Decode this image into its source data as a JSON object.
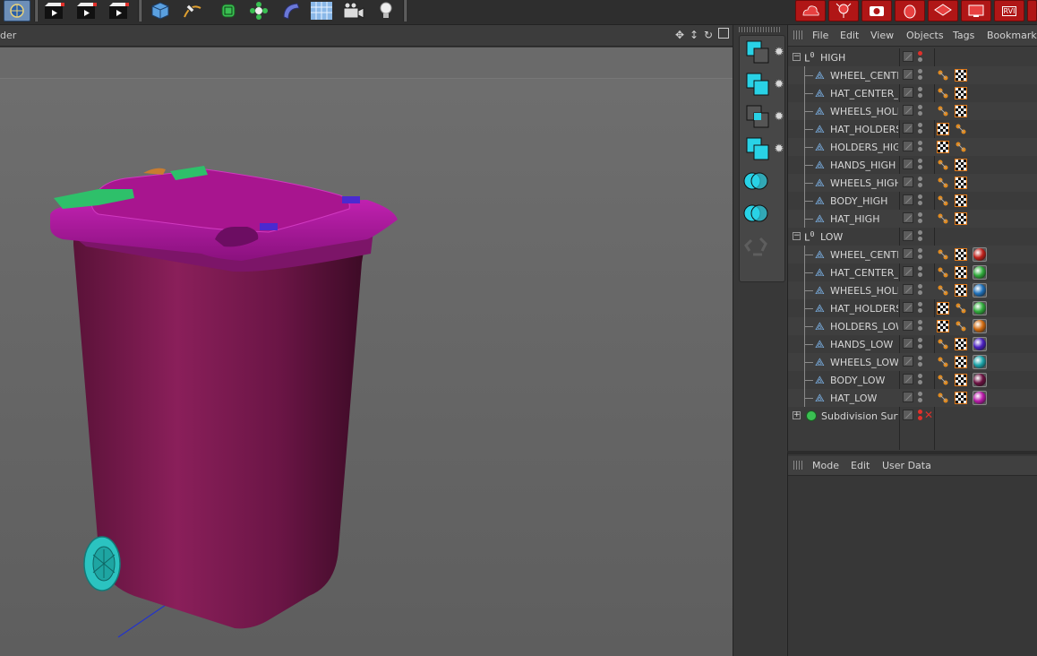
{
  "viewport": {
    "label": "der",
    "nav_icons": [
      "move-view-icon",
      "zoom-view-icon",
      "rotate-view-icon",
      "maximize-view-icon"
    ]
  },
  "toolbar": {
    "left_icons": [
      "coordinate-system-icon",
      "render-view-icon",
      "render-picture-queue-icon",
      "render-settings-icon"
    ],
    "object_icons": [
      "cube-icon",
      "pen-spline-icon",
      "subdivision-icon",
      "array-icon",
      "deformer-icon",
      "floor-icon",
      "camera-icon",
      "light-icon"
    ],
    "plugin_icons": [
      "plugin-cloud-icon",
      "plugin-tree-icon",
      "plugin-camera-icon",
      "plugin-figure-icon",
      "plugin-layers-icon",
      "plugin-monitor-icon",
      "plugin-rvl-icon"
    ],
    "plugin_text": "RVI"
  },
  "palette": {
    "tools": [
      "palette-tool-1",
      "palette-tool-2",
      "palette-tool-3",
      "palette-tool-4",
      "boolean-icon",
      "boolean-2-icon",
      "recycle-icon"
    ]
  },
  "object_manager": {
    "menu": [
      "File",
      "Edit",
      "View",
      "Objects",
      "Tags",
      "Bookmarks"
    ],
    "rows": [
      {
        "label": "HIGH",
        "kind": "null",
        "level": 0,
        "expanded": true,
        "tags": []
      },
      {
        "label": "WHEEL_CENTE",
        "kind": "poly",
        "level": 1,
        "tags": [
          "ik",
          "chk"
        ]
      },
      {
        "label": "HAT_CENTER_H",
        "kind": "poly",
        "level": 1,
        "tags": [
          "ik",
          "chk"
        ]
      },
      {
        "label": "WHEELS_HOLD",
        "kind": "poly",
        "level": 1,
        "tags": [
          "ik",
          "chk"
        ]
      },
      {
        "label": "HAT_HOLDERS",
        "kind": "poly",
        "level": 1,
        "tags": [
          "chk",
          "ik"
        ]
      },
      {
        "label": "HOLDERS_HIGH",
        "kind": "poly",
        "level": 1,
        "tags": [
          "chk",
          "ik"
        ]
      },
      {
        "label": "HANDS_HIGH",
        "kind": "poly",
        "level": 1,
        "tags": [
          "ik",
          "chk"
        ]
      },
      {
        "label": "WHEELS_HIGH",
        "kind": "poly",
        "level": 1,
        "tags": [
          "ik",
          "chk"
        ]
      },
      {
        "label": "BODY_HIGH",
        "kind": "poly",
        "level": 1,
        "tags": [
          "ik",
          "chk"
        ]
      },
      {
        "label": "HAT_HIGH",
        "kind": "poly",
        "level": 1,
        "tags": [
          "ik",
          "chk"
        ]
      },
      {
        "label": "LOW",
        "kind": "null",
        "level": 0,
        "expanded": true,
        "tags": []
      },
      {
        "label": "WHEEL_CENTE",
        "kind": "poly",
        "level": 1,
        "tags": [
          "ik",
          "chk",
          "mat:#c0201a"
        ]
      },
      {
        "label": "HAT_CENTER_L",
        "kind": "poly",
        "level": 1,
        "tags": [
          "ik",
          "chk",
          "mat:#2faa3a"
        ]
      },
      {
        "label": "WHEELS_HOLD",
        "kind": "poly",
        "level": 1,
        "tags": [
          "ik",
          "chk",
          "mat:#1e6fb8"
        ]
      },
      {
        "label": "HAT_HOLDERS",
        "kind": "poly",
        "level": 1,
        "tags": [
          "chk",
          "ik",
          "mat:#2faa3a"
        ]
      },
      {
        "label": "HOLDERS_LOW",
        "kind": "poly",
        "level": 1,
        "tags": [
          "chk",
          "ik",
          "mat:#d06a10"
        ]
      },
      {
        "label": "HANDS_LOW",
        "kind": "poly",
        "level": 1,
        "tags": [
          "ik",
          "chk",
          "mat:#4a1fc0"
        ]
      },
      {
        "label": "WHEELS_LOW",
        "kind": "poly",
        "level": 1,
        "tags": [
          "ik",
          "chk",
          "mat:#1aa3a8"
        ]
      },
      {
        "label": "BODY_LOW",
        "kind": "poly",
        "level": 1,
        "tags": [
          "ik",
          "chk",
          "mat:#6a1040"
        ]
      },
      {
        "label": "HAT_LOW",
        "kind": "poly",
        "level": 1,
        "tags": [
          "ik",
          "chk",
          "mat:#b81aa8"
        ]
      },
      {
        "label": "Subdivision Surfa",
        "kind": "subdiv",
        "level": 0,
        "expanded": false,
        "tags": []
      }
    ]
  },
  "attribute_manager": {
    "menu": [
      "Mode",
      "Edit",
      "User Data"
    ]
  },
  "colors": {
    "bin_body": "#7a1a4f",
    "bin_lid": "#b0189e",
    "lid_handle": "#2ec06a",
    "wheel": "#2bc3c0",
    "lid_tab": "#4a2ad0",
    "accent_cyan": "#29d2e6",
    "plugin_red": "#b01616"
  }
}
